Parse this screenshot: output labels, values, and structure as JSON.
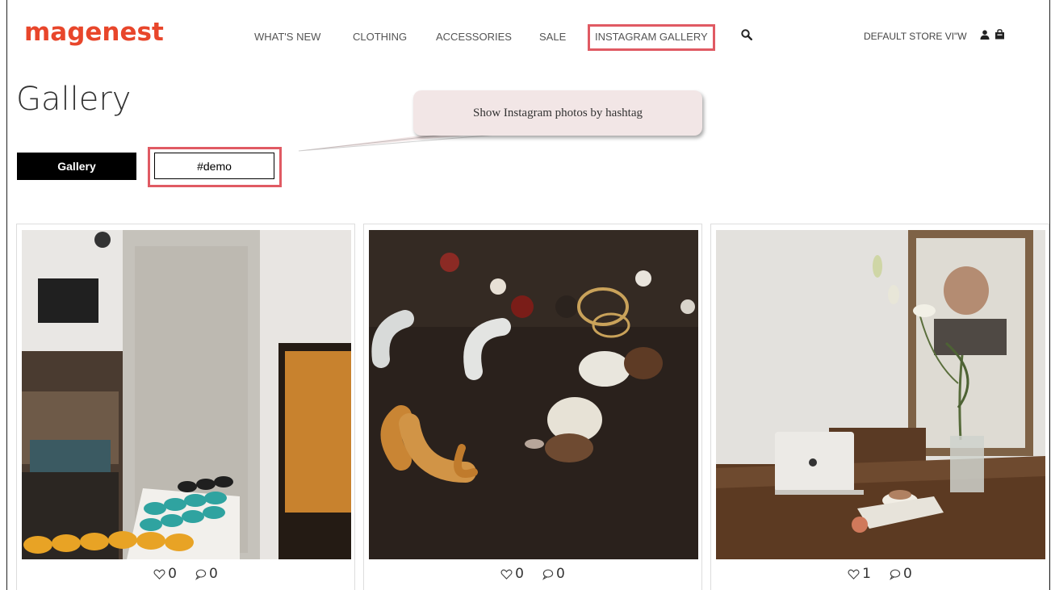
{
  "header": {
    "logo_text": "magenest",
    "nav": [
      {
        "label": "WHAT'S NEW"
      },
      {
        "label": "CLOTHING"
      },
      {
        "label": "ACCESSORIES"
      },
      {
        "label": "SALE"
      },
      {
        "label": "INSTAGRAM GALLERY"
      }
    ],
    "store_switcher": "DEFAULT STORE VI\"W",
    "icons": [
      "search-icon",
      "user-icon",
      "shopping-bag-icon"
    ]
  },
  "page": {
    "title": "Gallery",
    "tabs": [
      {
        "label": "Gallery"
      },
      {
        "label": "#demo"
      }
    ]
  },
  "annotation": {
    "callout_text": "Show Instagram photos by hashtag",
    "highlight_color": "#e05a63"
  },
  "gallery": {
    "items": [
      {
        "photo": "cafe-interior-teal-cups",
        "likes": "0",
        "comments": "0"
      },
      {
        "photo": "resin-hoop-earrings",
        "likes": "0",
        "comments": "0"
      },
      {
        "photo": "laptop-lily-table",
        "likes": "1",
        "comments": "0"
      }
    ]
  },
  "colors": {
    "brand": "#e8462b",
    "primary_button": "#000000"
  }
}
